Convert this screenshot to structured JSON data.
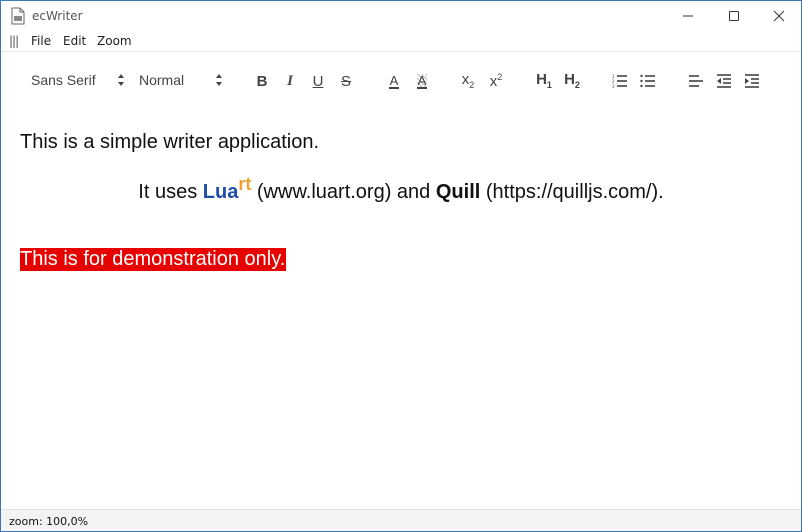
{
  "window": {
    "title": "ecWriter",
    "controls": [
      "minimize-icon",
      "maximize-icon",
      "close-icon"
    ]
  },
  "menu": {
    "handle": "|||",
    "items": [
      "File",
      "Edit",
      "Zoom"
    ]
  },
  "toolbar": {
    "font": "Sans Serif",
    "size": "Normal",
    "bold": "B",
    "italic": "I",
    "underline": "U",
    "strike": "S",
    "color": "A",
    "background": "A",
    "subscript": "x",
    "subscript_mark": "2",
    "superscript": "x",
    "superscript_mark": "2",
    "h1": "H",
    "h1_mark": "1",
    "h2": "H",
    "h2_mark": "2",
    "icons": [
      "ordered-list-icon",
      "bullet-list-icon",
      "align-left-icon",
      "outdent-icon",
      "indent-icon"
    ]
  },
  "document": {
    "line1": "This is a simple writer application.",
    "line2_pre": "It uses ",
    "line2_lua": "Lua",
    "line2_rt": "rt",
    "line2_mid": " (www.luart.org) and ",
    "line2_quill": "Quill",
    "line2_post": " (https://quilljs.com/).",
    "line3": "This is for demonstration only.",
    "colors": {
      "lua": "#1e4fa6",
      "rt": "#f0a030",
      "highlight_bg": "#e60000",
      "highlight_fg": "#ffffff"
    }
  },
  "status": {
    "text": "zoom: 100,0%"
  }
}
